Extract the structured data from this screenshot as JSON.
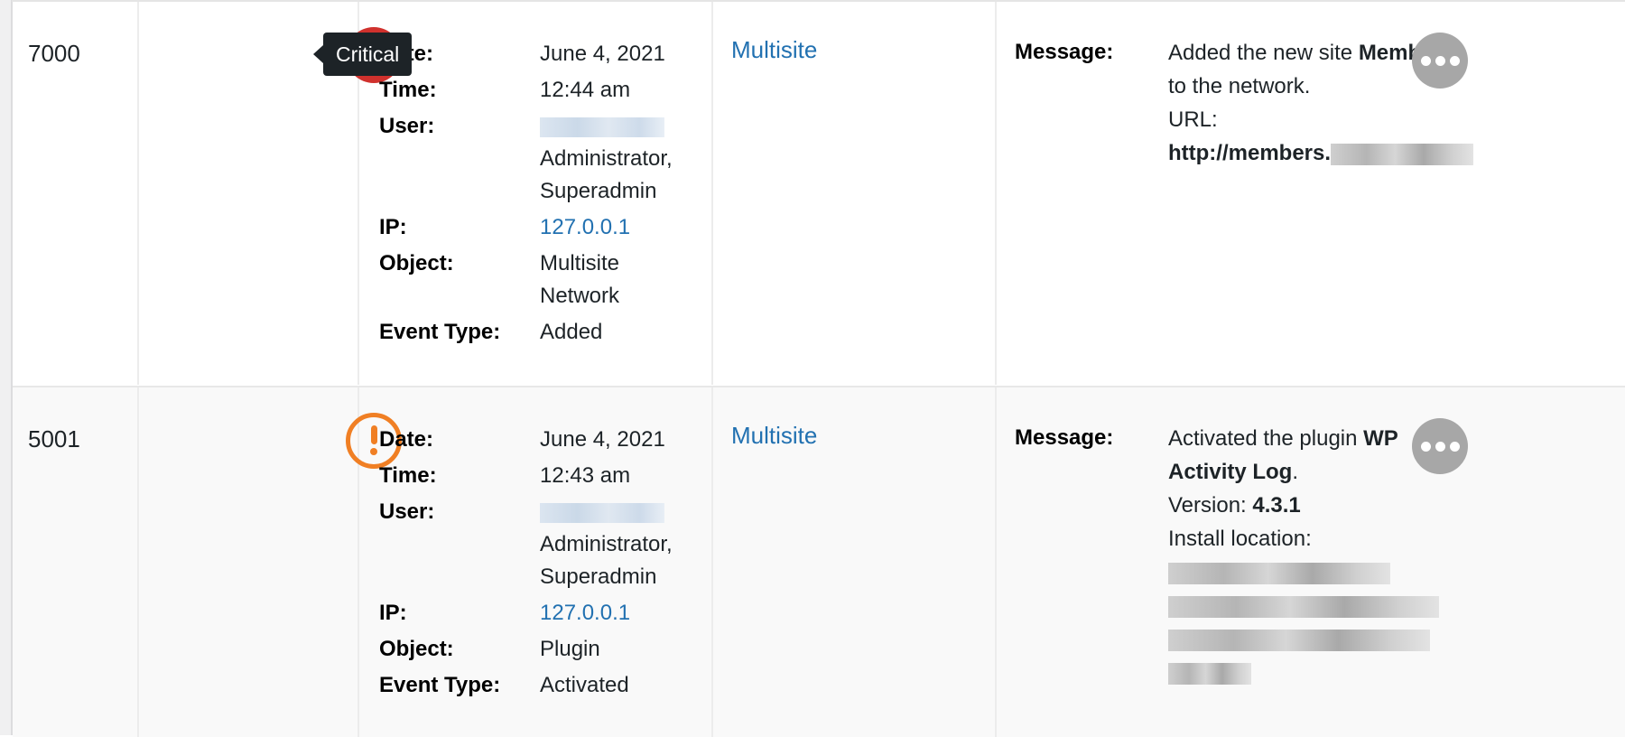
{
  "tooltip": "Critical",
  "labels": {
    "date": "Date:",
    "time": "Time:",
    "user": "User:",
    "ip": "IP:",
    "object": "Object:",
    "event_type": "Event Type:",
    "message": "Message:"
  },
  "colors": {
    "critical": "#d0312d",
    "high": "#f07f24",
    "link": "#2271b1",
    "more_button": "#a7a7a7"
  },
  "events": [
    {
      "id": "7000",
      "severity": "Critical",
      "severity_icon": "exclamation-circle-filled-icon",
      "date": "June 4, 2021",
      "time": "12:44 am",
      "user_roles_1": "Administrator,",
      "user_roles_2": "Superadmin",
      "ip": "127.0.0.1",
      "object_1": "Multisite",
      "object_2": "Network",
      "event_type": "Added",
      "site": "Multisite",
      "message": {
        "part1": "Added the new site ",
        "bold1": "Members",
        "part2": " to the network.",
        "url_label": "URL:",
        "url_prefix": "http://members."
      }
    },
    {
      "id": "5001",
      "severity": "High",
      "severity_icon": "exclamation-circle-outline-icon",
      "date": "June 4, 2021",
      "time": "12:43 am",
      "user_roles_1": "Administrator,",
      "user_roles_2": "Superadmin",
      "ip": "127.0.0.1",
      "object_1": "Plugin",
      "event_type": "Activated",
      "site": "Multisite",
      "message": {
        "part1": "Activated the plugin ",
        "bold1": "WP Activity Log",
        "part2": ".",
        "version_label": "Version: ",
        "version": "4.3.1",
        "install_label": "Install location:"
      }
    }
  ]
}
